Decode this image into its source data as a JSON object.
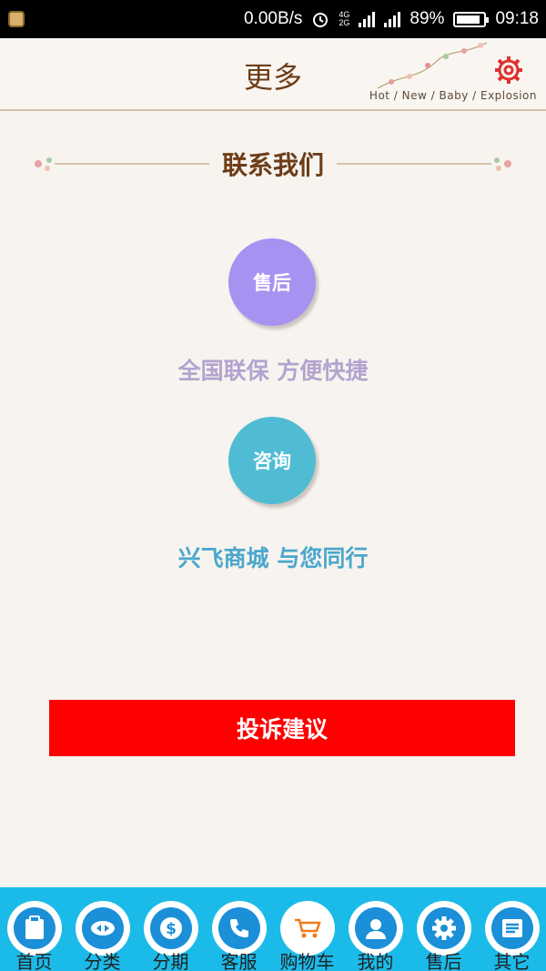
{
  "status_bar": {
    "net_speed": "0.00B/s",
    "net_4g": "4G",
    "net_2g": "2G",
    "battery": "89%",
    "time": "09:18"
  },
  "header": {
    "title": "更多",
    "tagline": "Hot / New / Baby / Explosion"
  },
  "contact": {
    "heading": "联系我们",
    "after_sales_button": "售后",
    "after_sales_text": "全国联保 方便快捷",
    "consult_button": "咨询",
    "consult_text": "兴飞商城  与您同行"
  },
  "complaint_button": "投诉建议",
  "bottom_nav": {
    "items": [
      {
        "label": "首页",
        "icon": "clipboard-icon"
      },
      {
        "label": "分类",
        "icon": "arrows-icon"
      },
      {
        "label": "分期",
        "icon": "dollar-icon"
      },
      {
        "label": "客服",
        "icon": "phone-icon"
      },
      {
        "label": "购物车",
        "icon": "cart-icon"
      },
      {
        "label": "我的",
        "icon": "user-icon"
      },
      {
        "label": "售后",
        "icon": "gear-icon"
      },
      {
        "label": "其它",
        "icon": "menu-icon"
      }
    ]
  },
  "colors": {
    "header_text": "#6d3d18",
    "after_sales": "#a892f1",
    "consult": "#4fbcd3",
    "complaint": "#ff0000",
    "nav_bg": "#1bbbe9"
  }
}
